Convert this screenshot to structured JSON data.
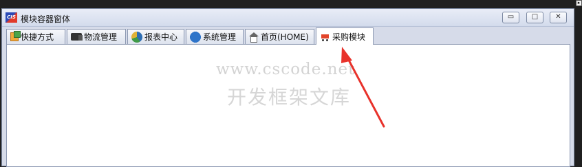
{
  "window": {
    "logo_text": "CIS",
    "title": "模块容器窗体"
  },
  "controls": {
    "minimize_icon": "minimize-icon",
    "maximize_icon": "maximize-icon",
    "close_icon": "close-icon"
  },
  "tabs": [
    {
      "label": "快捷方式",
      "icon": "shortcut-icon"
    },
    {
      "label": "物流管理",
      "icon": "truck-icon"
    },
    {
      "label": "报表中心",
      "icon": "pie-chart-icon"
    },
    {
      "label": "系统管理",
      "icon": "gear-icon"
    },
    {
      "label": "首页(HOME)",
      "icon": "home-icon"
    },
    {
      "label": "采购模块",
      "icon": "cart-icon",
      "active": true
    }
  ],
  "watermark": {
    "url": "www.cscode.net",
    "name": "开发框架文库"
  },
  "colors": {
    "window_bg": "#d6dbe9",
    "content_bg": "#ffffff",
    "annotation_arrow": "#e8322b"
  }
}
